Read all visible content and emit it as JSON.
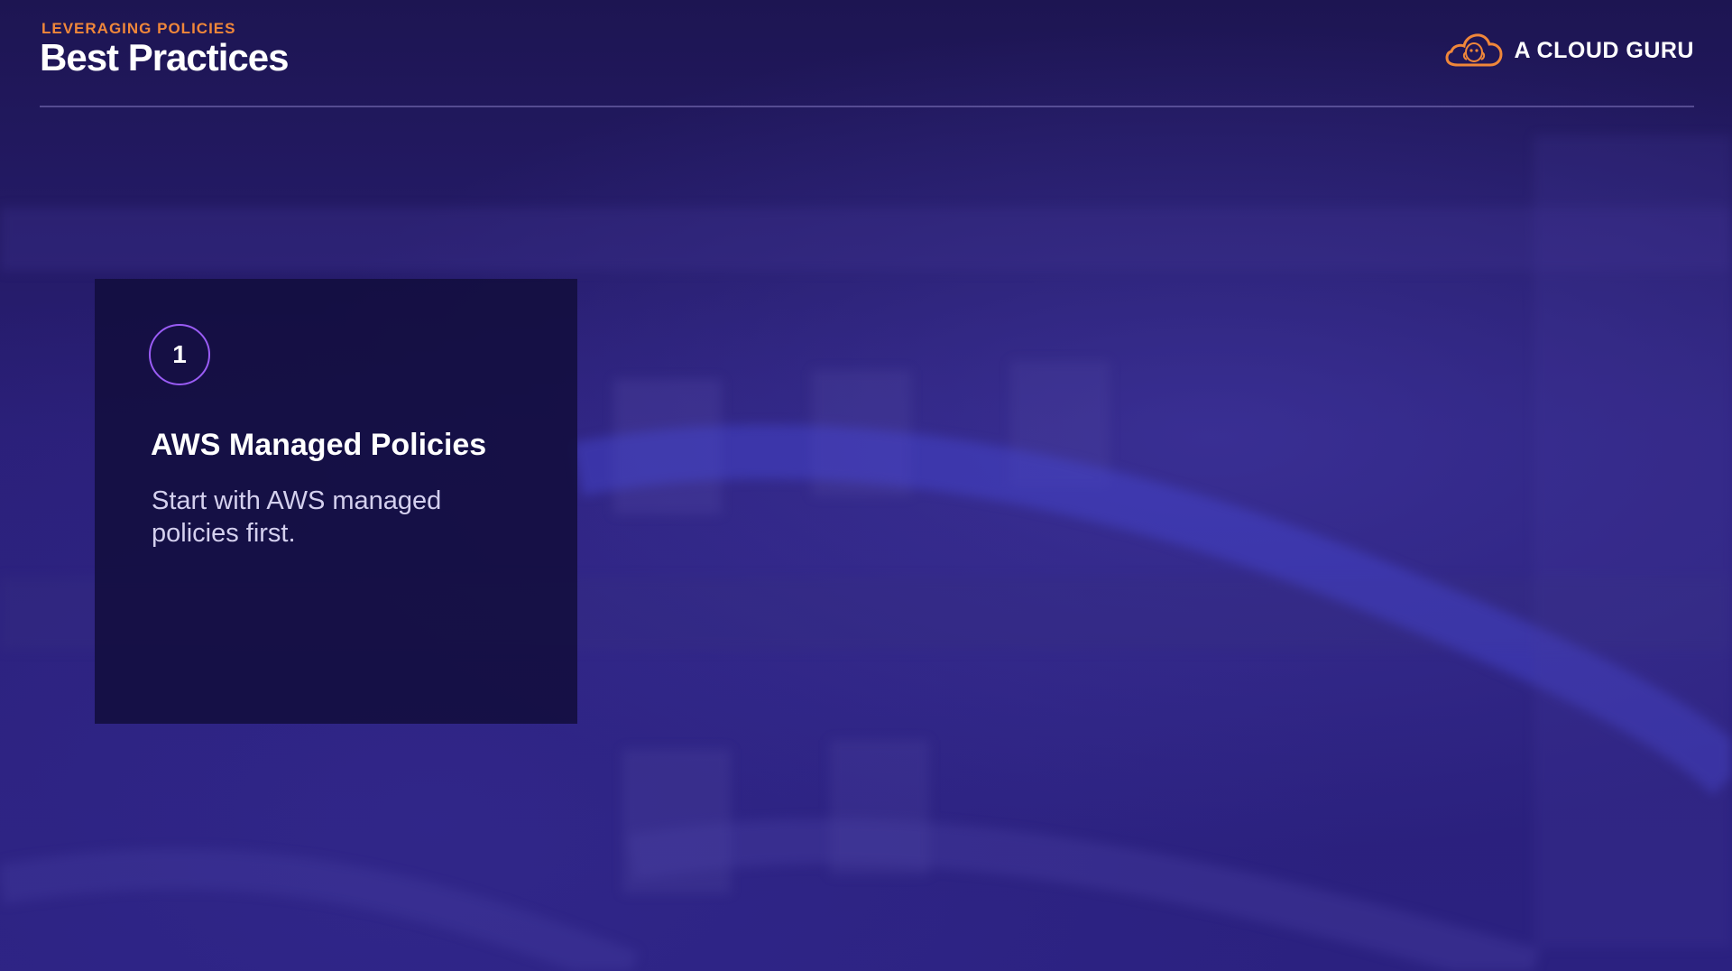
{
  "header": {
    "kicker": "LEVERAGING POLICIES",
    "title": "Best Practices"
  },
  "brand": {
    "name": "A CLOUD GURU",
    "logo_icon": "cloud-logo-icon",
    "logo_color": "#f0873a"
  },
  "card": {
    "step_number": "1",
    "title": "AWS Managed Policies",
    "body": "Start with AWS managed policies first."
  },
  "colors": {
    "accent": "#f0873a",
    "badge_ring": "#9a5cf5",
    "background": "#261c6b"
  }
}
